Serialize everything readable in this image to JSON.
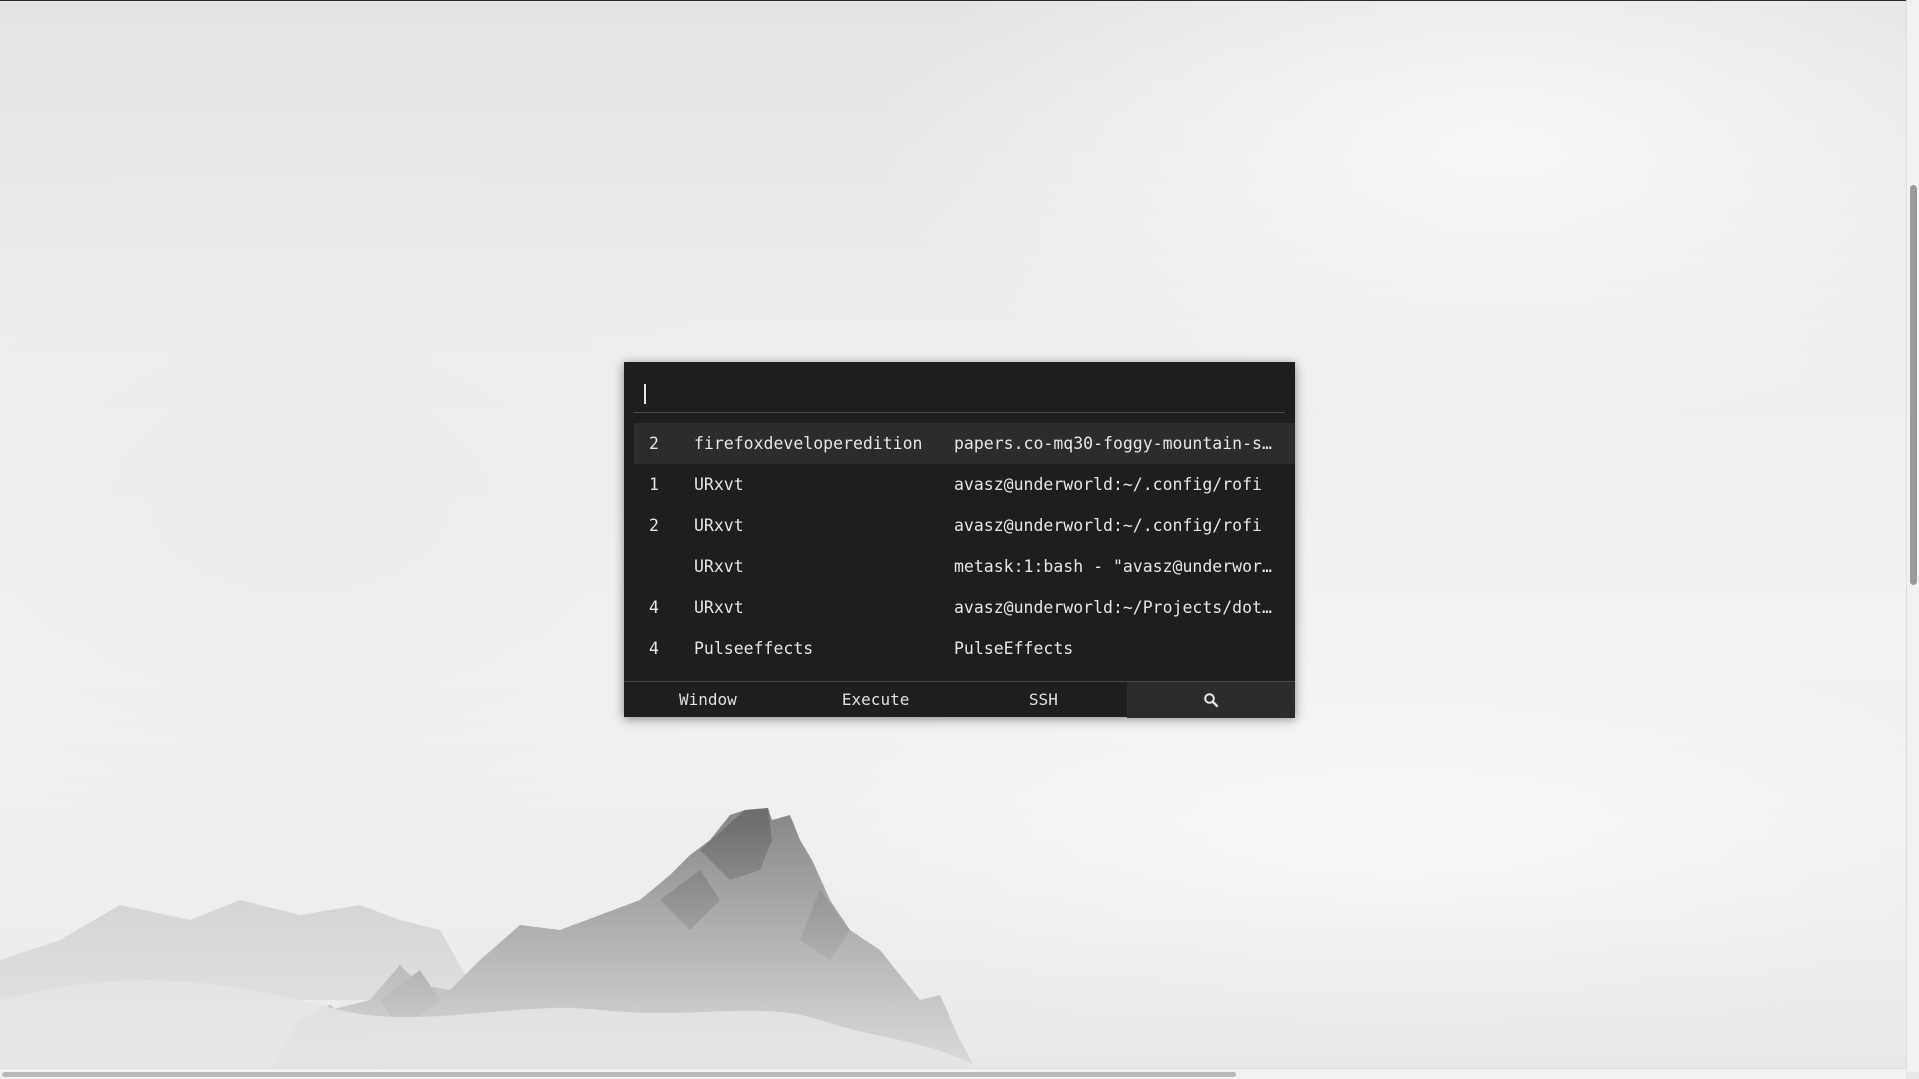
{
  "rofi": {
    "input": {
      "value": "",
      "placeholder": ""
    },
    "rows": [
      {
        "workspace": "2",
        "class": "firefoxdeveloperedition",
        "title": "papers.co-mq30-foggy-mountain-s…",
        "selected": true
      },
      {
        "workspace": "1",
        "class": "URxvt",
        "title": "avasz@underworld:~/.config/rofi",
        "selected": false
      },
      {
        "workspace": "2",
        "class": "URxvt",
        "title": "avasz@underworld:~/.config/rofi",
        "selected": false
      },
      {
        "workspace": "",
        "class": "URxvt",
        "title": "metask:1:bash - \"avasz@underwor…",
        "selected": false
      },
      {
        "workspace": "4",
        "class": "URxvt",
        "title": "avasz@underworld:~/Projects/dot…",
        "selected": false
      },
      {
        "workspace": "4",
        "class": "Pulseeffects",
        "title": "PulseEffects",
        "selected": false
      }
    ],
    "modes": [
      {
        "label": "Window"
      },
      {
        "label": "Execute"
      },
      {
        "label": "SSH"
      },
      {
        "label": "",
        "icon": "search-icon",
        "active": true
      }
    ]
  },
  "colors": {
    "window_bg": "#1e1e1e",
    "selected_bg": "#2c2c2c",
    "text": "#e6e6e6"
  }
}
